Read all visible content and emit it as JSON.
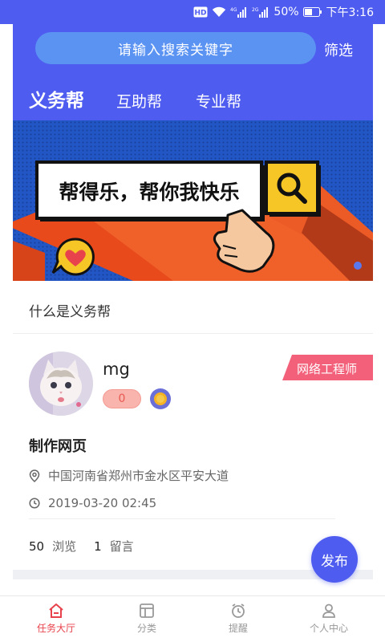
{
  "status_bar": {
    "hd_label": "HD",
    "network_1": "4G",
    "network_2": "2G",
    "battery": "50%",
    "time": "下午3:16"
  },
  "header": {
    "search_placeholder": "请输入搜索关键字",
    "filter_label": "筛选",
    "tabs": [
      {
        "label": "义务帮",
        "active": true
      },
      {
        "label": "互助帮",
        "active": false
      },
      {
        "label": "专业帮",
        "active": false
      }
    ]
  },
  "banner": {
    "slogan": "帮得乐，帮你我快乐",
    "slide_count": 1,
    "active_slide": 1
  },
  "section": {
    "title": "什么是义务帮"
  },
  "task_card": {
    "username": "mg",
    "count": "0",
    "role_tag": "网络工程师",
    "title": "制作网页",
    "location": "中国河南省郑州市金水区平安大道",
    "datetime": "2019-03-20 02:45",
    "views_count": "50",
    "views_label": "浏览",
    "comments_count": "1",
    "comments_label": "留言"
  },
  "publish_button": {
    "label": "发布"
  },
  "bottom_nav": {
    "items": [
      {
        "label": "任务大厅",
        "icon": "home-icon",
        "active": true
      },
      {
        "label": "分类",
        "icon": "category-icon",
        "active": false
      },
      {
        "label": "提醒",
        "icon": "alarm-clock-icon",
        "active": false
      },
      {
        "label": "个人中心",
        "icon": "user-icon",
        "active": false
      }
    ]
  },
  "colors": {
    "primary": "#4f5cf0",
    "search_bg": "#5b93f3",
    "tag": "#f2607a",
    "nav_active": "#e8424c"
  }
}
